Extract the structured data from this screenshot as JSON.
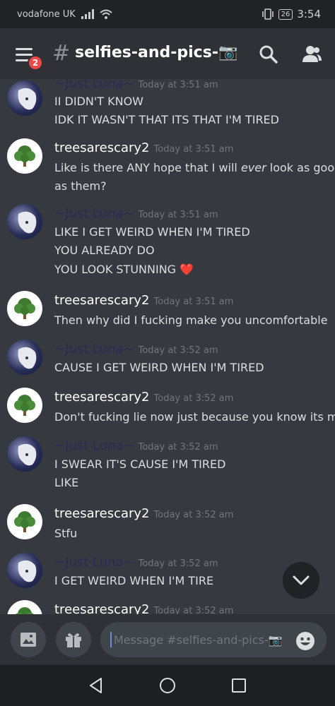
{
  "status": {
    "carrier": "vodafone UK",
    "battery": "26",
    "time": "3:54"
  },
  "header": {
    "notification_badge": "2",
    "hash": "#",
    "channel_name": "selfies-and-pics-📷"
  },
  "messages": [
    {
      "author": "~Just Luna~",
      "timestamp": "Today at 3:51 am",
      "lines": [
        "II DIDN'T KNOW",
        "IDK IT WASN'T THAT ITS THAT I'M TIRED"
      ]
    },
    {
      "author": "treesarescary2",
      "timestamp": "Today at 3:51 am",
      "lines_rich": {
        "l1_a": "Like is there ANY hope that I will ",
        "l1_em": "ever",
        "l1_b": " look as good",
        "l2": "as them?"
      }
    },
    {
      "author": "~Just Luna~",
      "timestamp": "Today at 3:51 am",
      "lines": [
        "LIKE I GET WEIRD WHEN I'M TIRED",
        "YOU ALREADY DO",
        "YOU LOOK STUNNING"
      ],
      "emoji": "❤️"
    },
    {
      "author": "treesarescary2",
      "timestamp": "Today at 3:51 am",
      "lines": [
        "Then why did I fucking make you uncomfortable"
      ]
    },
    {
      "author": "~Just Luna~",
      "timestamp": "Today at 3:52 am",
      "lines": [
        "CAUSE I GET WEIRD WHEN I'M TIRED"
      ]
    },
    {
      "author": "treesarescary2",
      "timestamp": "Today at 3:52 am",
      "lines": [
        "Don't fucking lie now just because you know its me"
      ]
    },
    {
      "author": "~Just Luna~",
      "timestamp": "Today at 3:52 am",
      "lines": [
        "I SWEAR IT'S CAUSE I'M TIRED",
        "LIKE"
      ]
    },
    {
      "author": "treesarescary2",
      "timestamp": "Today at 3:52 am",
      "lines": [
        "Stfu"
      ]
    },
    {
      "author": "~Just Luna~",
      "timestamp": "Today at 3:52 am",
      "lines": [
        "I GET WEIRD WHEN I'M TIRE"
      ]
    },
    {
      "author": "treesarescary2",
      "timestamp": "Today at 3:52 am",
      "lines": []
    }
  ],
  "composer": {
    "placeholder": "Message #selfies-and-pics-📷"
  },
  "colors": {
    "background": "#36393f",
    "header": "#2f3136",
    "accent": "#7289da",
    "badge": "#f04747",
    "luna_name": "#2e2a57"
  },
  "icons": [
    "menu-icon",
    "search-icon",
    "members-icon",
    "image-icon",
    "gift-icon",
    "emoji-icon",
    "chevron-down-icon",
    "back-nav-icon",
    "home-nav-icon",
    "recents-nav-icon"
  ]
}
